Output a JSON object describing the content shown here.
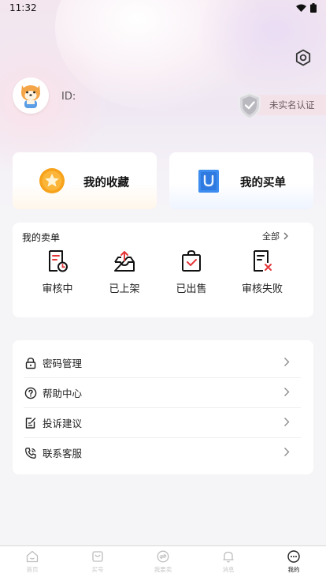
{
  "status_bar": {
    "time": "11:32"
  },
  "profile": {
    "id_label": "ID:",
    "verify_status": "未实名认证"
  },
  "quick_actions": {
    "favorites": "我的收藏",
    "purchases": "我的买单"
  },
  "sell_orders": {
    "title": "我的卖单",
    "all_label": "全部",
    "items": [
      {
        "label": "审核中",
        "icon": "document-clock-icon"
      },
      {
        "label": "已上架",
        "icon": "inbox-upload-icon"
      },
      {
        "label": "已出售",
        "icon": "bag-check-icon"
      },
      {
        "label": "审核失败",
        "icon": "document-cross-icon"
      }
    ]
  },
  "menu": [
    {
      "label": "密码管理",
      "icon": "lock-icon"
    },
    {
      "label": "帮助中心",
      "icon": "help-icon"
    },
    {
      "label": "投诉建议",
      "icon": "edit-note-icon"
    },
    {
      "label": "联系客服",
      "icon": "phone-icon"
    }
  ],
  "tabbar": {
    "active_index": 4,
    "items": [
      {
        "label": "首页",
        "icon": "home-icon"
      },
      {
        "label": "买号",
        "icon": "cart-icon"
      },
      {
        "label": "我要卖",
        "icon": "exchange-icon"
      },
      {
        "label": "消息",
        "icon": "bell-icon"
      },
      {
        "label": "我的",
        "icon": "profile-dots-icon"
      }
    ]
  },
  "colors": {
    "accent_red": "#e5373a",
    "page_bg": "#f5f5f7",
    "star_orange": "#f7a21b",
    "bag_blue": "#3d8df0"
  }
}
